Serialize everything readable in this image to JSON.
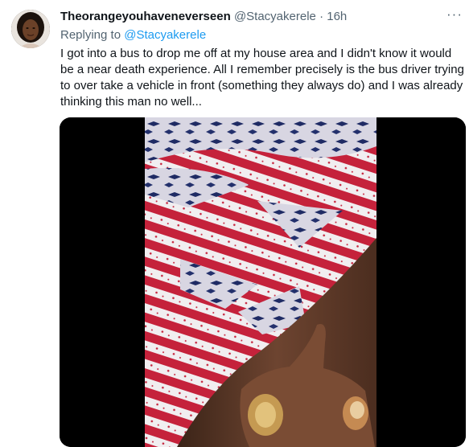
{
  "tweet": {
    "display_name": "Theorangeyouhaveneverseen",
    "handle": "@Stacyakerele",
    "separator": "·",
    "time": "16h",
    "more_icon": "more-horizontal-icon",
    "reply_prefix": "Replying to",
    "reply_mention": "@Stacyakerele",
    "text": "I got into a bus to drop me off at my house area and I didn't know it would be a near death  experience. All I remember precisely is the bus driver trying to over take a vehicle in front (something they always do) and I was already thinking this man no well...",
    "media_type": "video"
  },
  "colors": {
    "link": "#1d9bf0",
    "secondary_text": "#536471",
    "primary_text": "#0f1419",
    "media_background": "#000000"
  }
}
